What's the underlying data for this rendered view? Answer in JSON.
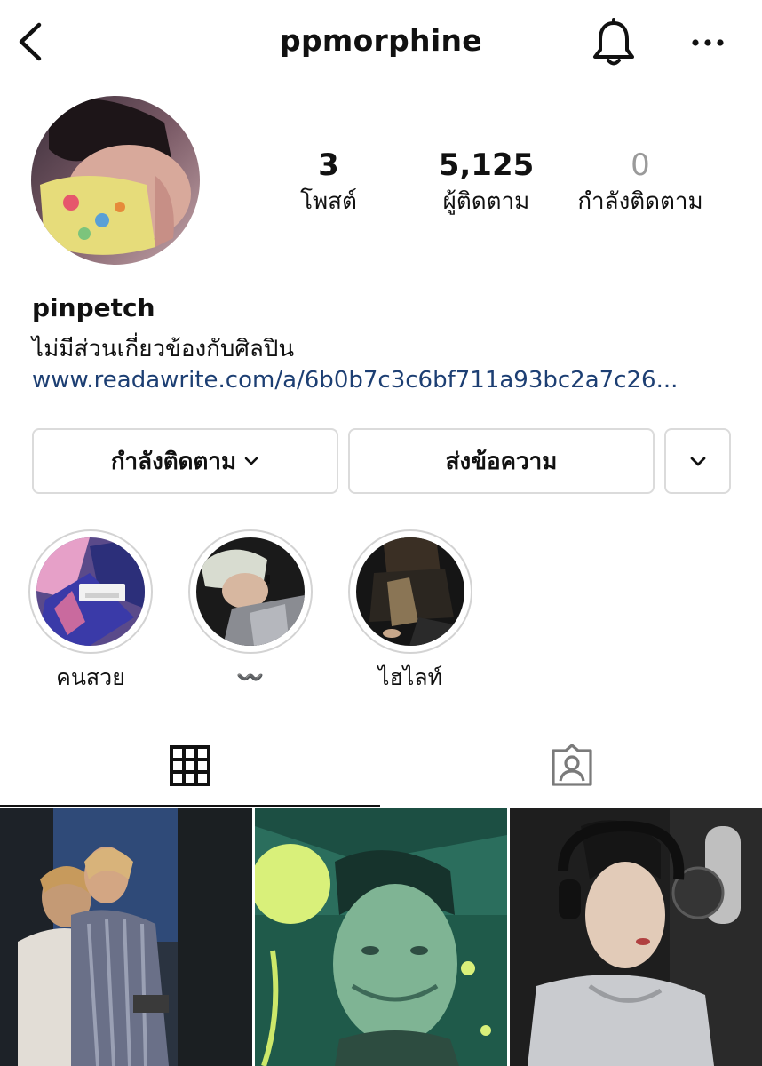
{
  "header": {
    "username": "ppmorphine",
    "back_icon": "chevron-left-icon",
    "bell_icon": "bell-icon",
    "more_icon": "more-horizontal-icon"
  },
  "profile": {
    "stats": {
      "posts": {
        "value": "3",
        "label": "โพสต์"
      },
      "followers": {
        "value": "5,125",
        "label": "ผู้ติดตาม"
      },
      "following": {
        "value": "0",
        "label": "กำลังติดตาม"
      }
    },
    "name": "pinpetch",
    "bio": "ไม่มีส่วนเกี่ยวข้องกับศิลปิน",
    "link": "www.readawrite.com/a/6b0b7c3c6bf711a93bc2a7c26..."
  },
  "actions": {
    "following_label": "กำลังติดตาม",
    "message_label": "ส่งข้อความ"
  },
  "highlights": [
    {
      "label": "คนสวย"
    },
    {
      "label": "〰️"
    },
    {
      "label": "ไฮไลท์"
    }
  ],
  "tabs": {
    "grid_icon": "grid-icon",
    "tagged_icon": "tagged-person-icon",
    "active": "grid"
  },
  "colors": {
    "link": "#1d3f73",
    "border": "#dbdbdb",
    "muted": "#9a9a9a"
  }
}
